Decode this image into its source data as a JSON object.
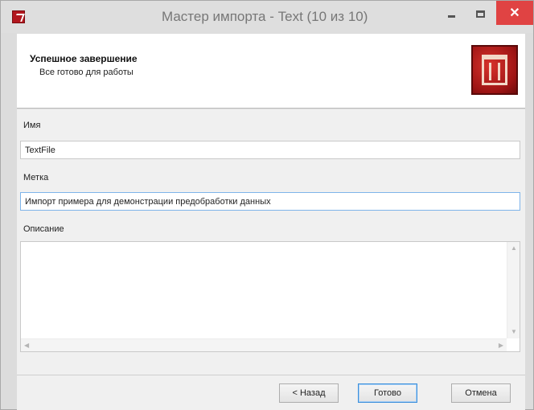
{
  "window": {
    "title": "Мастер импорта - Text (10 из 10)",
    "close_glyph": "✕"
  },
  "header": {
    "title": "Успешное завершение",
    "subtitle": "Все готово для работы"
  },
  "form": {
    "name_label": "Имя",
    "name_value": "TextFile",
    "tag_label": "Метка",
    "tag_value": "Импорт примера для демонстрации предобработки данных",
    "description_label": "Описание",
    "description_value": ""
  },
  "buttons": {
    "back": "< Назад",
    "finish": "Готово",
    "cancel": "Отмена"
  },
  "colors": {
    "close_button": "#e04343",
    "logo": "#b2161e",
    "focus_border": "#7eb4ea"
  },
  "icons": [
    "app-icon",
    "minimize-icon",
    "maximize-icon",
    "close-icon",
    "wizard-logo-icon"
  ]
}
